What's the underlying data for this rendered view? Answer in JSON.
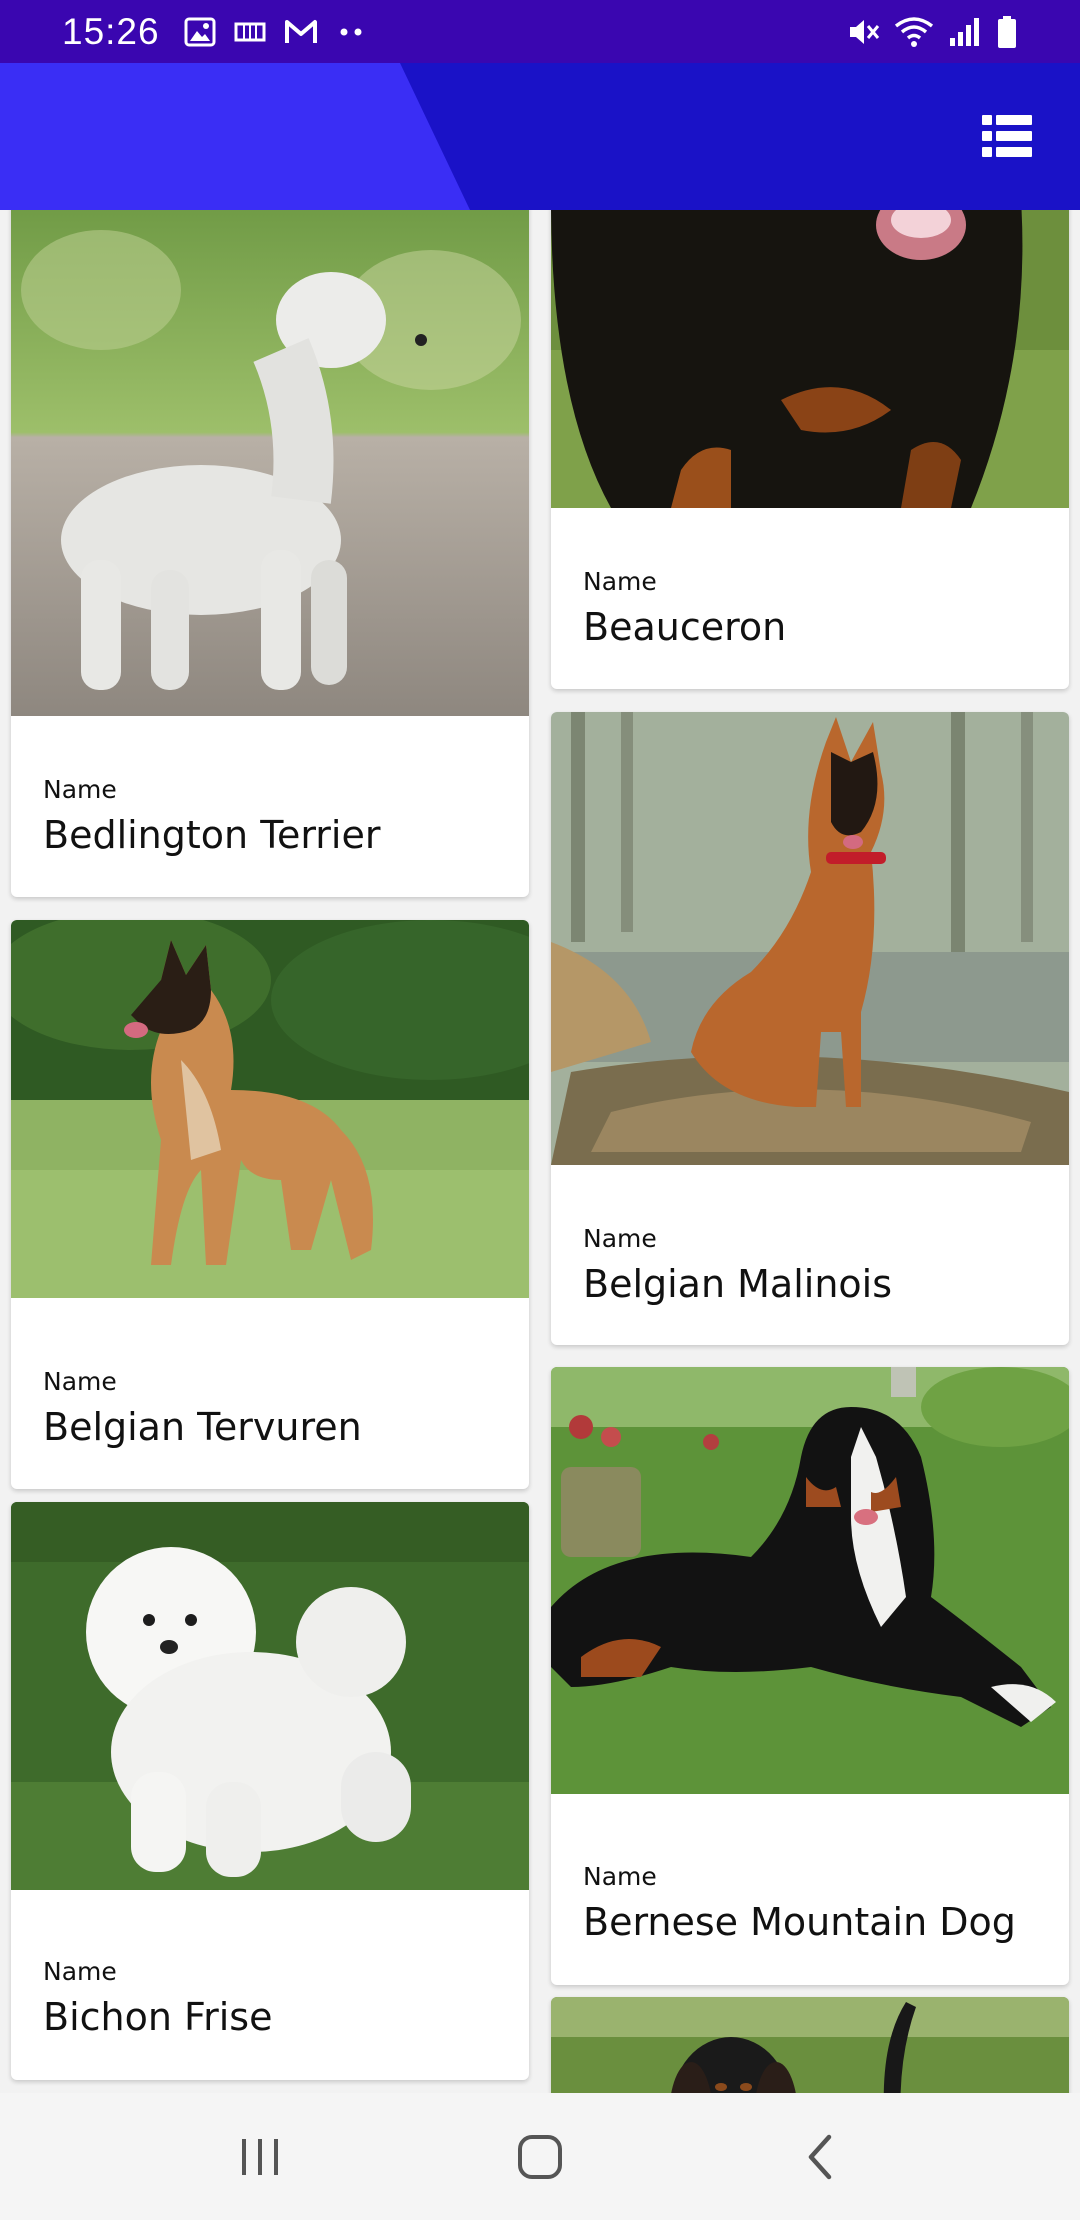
{
  "status_bar": {
    "time": "15:26",
    "left_icons": [
      "image-icon",
      "voicemail-icon",
      "gmail-icon",
      "more-dots-icon"
    ],
    "right_icons": [
      "mute-icon",
      "wifi-icon",
      "signal-icon",
      "battery-icon"
    ]
  },
  "app_bar": {
    "action_icon": "list-view-icon",
    "colors": {
      "status": "#3a06b0",
      "bar": "#1a12c7",
      "accent": "#3a2ef5"
    }
  },
  "cards": [
    {
      "label": "Name",
      "value": "Bedlington Terrier"
    },
    {
      "label": "Name",
      "value": "Beauceron"
    },
    {
      "label": "Name",
      "value": "Belgian Tervuren"
    },
    {
      "label": "Name",
      "value": "Belgian Malinois"
    },
    {
      "label": "Name",
      "value": "Bichon Frise"
    },
    {
      "label": "Name",
      "value": "Bernese Mountain Dog"
    }
  ],
  "nav_bar": {
    "icons": [
      "recent-apps-icon",
      "home-icon",
      "back-icon"
    ]
  }
}
